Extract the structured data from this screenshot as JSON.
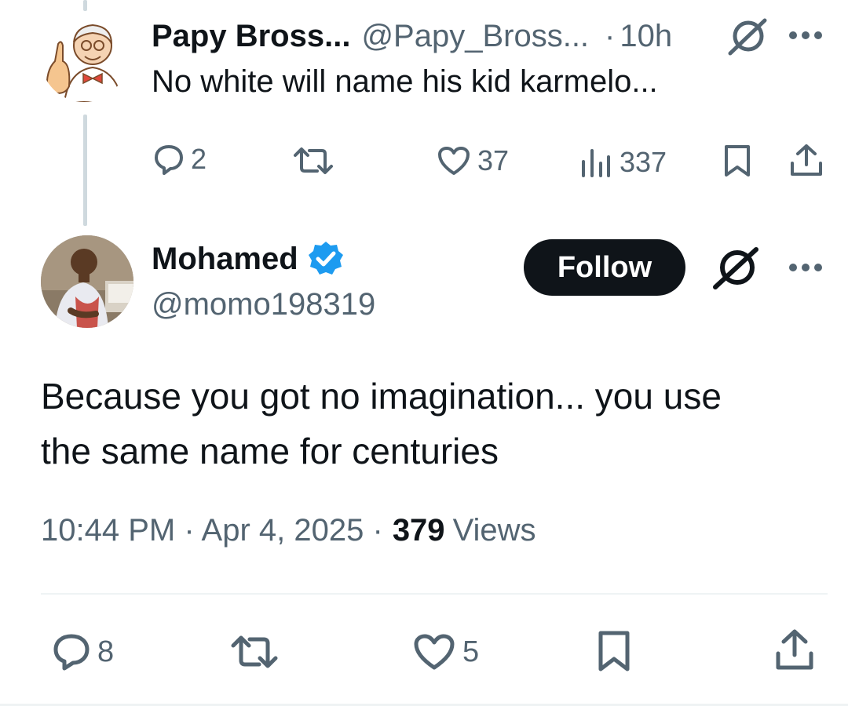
{
  "reply_parent": {
    "display_name": "Papy Bross...",
    "handle": "@Papy_Bross...",
    "separator": "·",
    "time": "10h",
    "text": "No white will name his kid karmelo...",
    "actions": {
      "replies": "2",
      "likes": "37",
      "views": "337"
    }
  },
  "main_tweet": {
    "display_name": "Mohamed",
    "handle": "@momo198319",
    "follow_label": "Follow",
    "text_line1": "Because you got no imagination... you use",
    "text_line2": "the same name for centuries",
    "timestamp": "10:44 PM · Apr 4, 2025 ·",
    "views_count": "379",
    "views_label": "Views",
    "actions": {
      "replies": "8",
      "likes": "5"
    }
  },
  "colors": {
    "text": "#0f1419",
    "muted": "#536471",
    "verified": "#1d9bf0",
    "thread_line": "#cfd9de"
  },
  "icons": [
    "more-icon",
    "grok-icon",
    "reply-icon",
    "retweet-icon",
    "like-icon",
    "views-icon",
    "bookmark-icon",
    "share-icon",
    "verified-badge-icon"
  ]
}
